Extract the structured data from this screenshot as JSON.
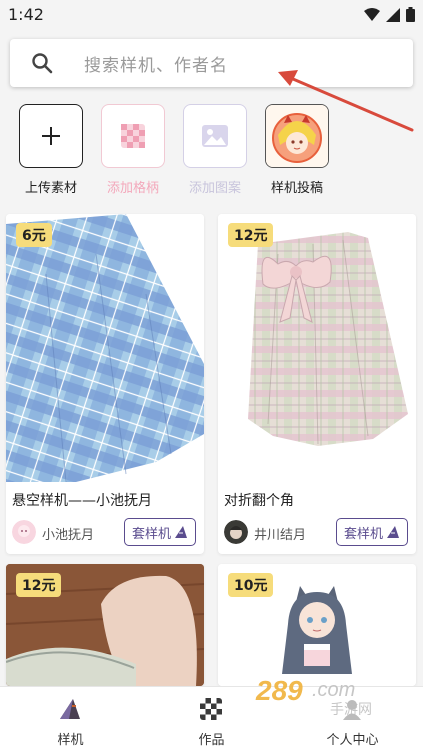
{
  "status_bar": {
    "time": "1:42"
  },
  "search": {
    "placeholder": "搜索样机、作者名"
  },
  "quick_actions": [
    {
      "label": "上传素材",
      "color": "#222222"
    },
    {
      "label": "添加格柄",
      "color": "#f3a8bb"
    },
    {
      "label": "添加图案",
      "color": "#c8c4dc"
    },
    {
      "label": "样机投稿",
      "color": "#222222"
    }
  ],
  "cards": [
    {
      "price": "6元",
      "title": "悬空样机——小池抚月",
      "author": "小池抚月",
      "action": "套样机"
    },
    {
      "price": "12元",
      "title": "对折翻个角",
      "author": "井川结月",
      "action": "套样机"
    },
    {
      "price": "12元"
    },
    {
      "price": "10元"
    }
  ],
  "bottom_nav": [
    {
      "label": "样机"
    },
    {
      "label": "作品"
    },
    {
      "label": "个人中心"
    }
  ],
  "colors": {
    "accent": "#5a4c8e",
    "badge": "#f6dc7b",
    "arrow": "#d84a3c"
  },
  "watermark": {
    "text": "289.com 手游网"
  }
}
